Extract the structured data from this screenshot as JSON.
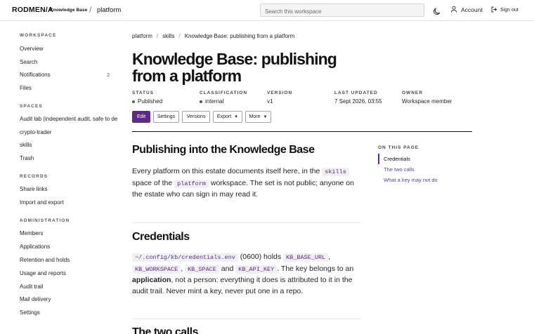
{
  "header": {
    "brand": "RODMEN/A",
    "brand_sub": "Knowledge Base",
    "separator": "/",
    "space": "platform",
    "search_placeholder": "Search this workspace",
    "theme_icon": "moon-icon",
    "account_label": "Account",
    "signout_label": "Sign out"
  },
  "sidebar": {
    "workspace_heading": "WORKSPACE",
    "workspace_items": [
      {
        "label": "Overview",
        "count": ""
      },
      {
        "label": "Search",
        "count": ""
      },
      {
        "label": "Notifications",
        "count": "2"
      },
      {
        "label": "Files",
        "count": ""
      }
    ],
    "spaces_heading": "SPACES",
    "spaces_items": [
      {
        "label": "Audit lab (independent audit, safe to de"
      },
      {
        "label": "crypto-trader"
      },
      {
        "label": "skills"
      },
      {
        "label": "Trash"
      }
    ],
    "records_heading": "RECORDS",
    "records_items": [
      {
        "label": "Share links"
      },
      {
        "label": "Import and export"
      }
    ],
    "admin_heading": "ADMINISTRATION",
    "admin_items": [
      {
        "label": "Members"
      },
      {
        "label": "Applications"
      },
      {
        "label": "Retention and holds"
      },
      {
        "label": "Usage and reports"
      },
      {
        "label": "Audit trail"
      },
      {
        "label": "Mail delivery"
      },
      {
        "label": "Settings"
      }
    ]
  },
  "breadcrumb": {
    "items": [
      "platform",
      "skills",
      "Knowledge Base: publishing from a platform"
    ],
    "separator": "/"
  },
  "page": {
    "title": "Knowledge Base: publishing from a platform",
    "meta": {
      "status_label": "STATUS",
      "status_value": "Published",
      "status_color": "#2e7d32",
      "classification_label": "CLASSIFICATION",
      "classification_value": "internal",
      "classification_color": "#555555",
      "version_label": "VERSION",
      "version_value": "v1",
      "updated_label": "LAST UPDATED",
      "updated_value": "7 Sept 2026, 03:55",
      "owner_label": "OWNER",
      "owner_value": "Workspace member"
    },
    "actions": {
      "edit": "Edit",
      "settings": "Settings",
      "versions": "Versions",
      "export": "Export",
      "more": "More"
    },
    "sections": {
      "s1_title": "Publishing into the Knowledge Base",
      "s1_p_a": "Every platform on this estate documents itself here, in the",
      "s1_code_skills": "skills",
      "s1_p_b": "space of the",
      "s1_code_platform": "platform",
      "s1_p_c": "workspace. The set is not public; anyone on the estate who can sign in may read it.",
      "s2_title": "Credentials",
      "s2_code_path": "~/.config/kb/credentials.env",
      "s2_p_a": "(0600) holds",
      "s2_code_url": "KB_BASE_URL",
      "s2_comma1": ",",
      "s2_code_ws": "KB_WORKSPACE",
      "s2_comma2": ",",
      "s2_code_space": "KB_SPACE",
      "s2_and": "and",
      "s2_code_key": "KB_API_KEY",
      "s2_p_b": ". The key belongs to an",
      "s2_bold": "application",
      "s2_p_c": ", not a person: everything it does is attributed to it in the audit trail. Never mint a key, never put one in a repo.",
      "s3_title": "The two calls"
    }
  },
  "toc": {
    "heading": "ON THIS PAGE",
    "items": [
      "Credentials",
      "The two calls",
      "What a key may not do"
    ],
    "active_color": "#5b2a86",
    "link_color": "#4a4a8a"
  },
  "colors": {
    "accent": "#5b2a86"
  }
}
